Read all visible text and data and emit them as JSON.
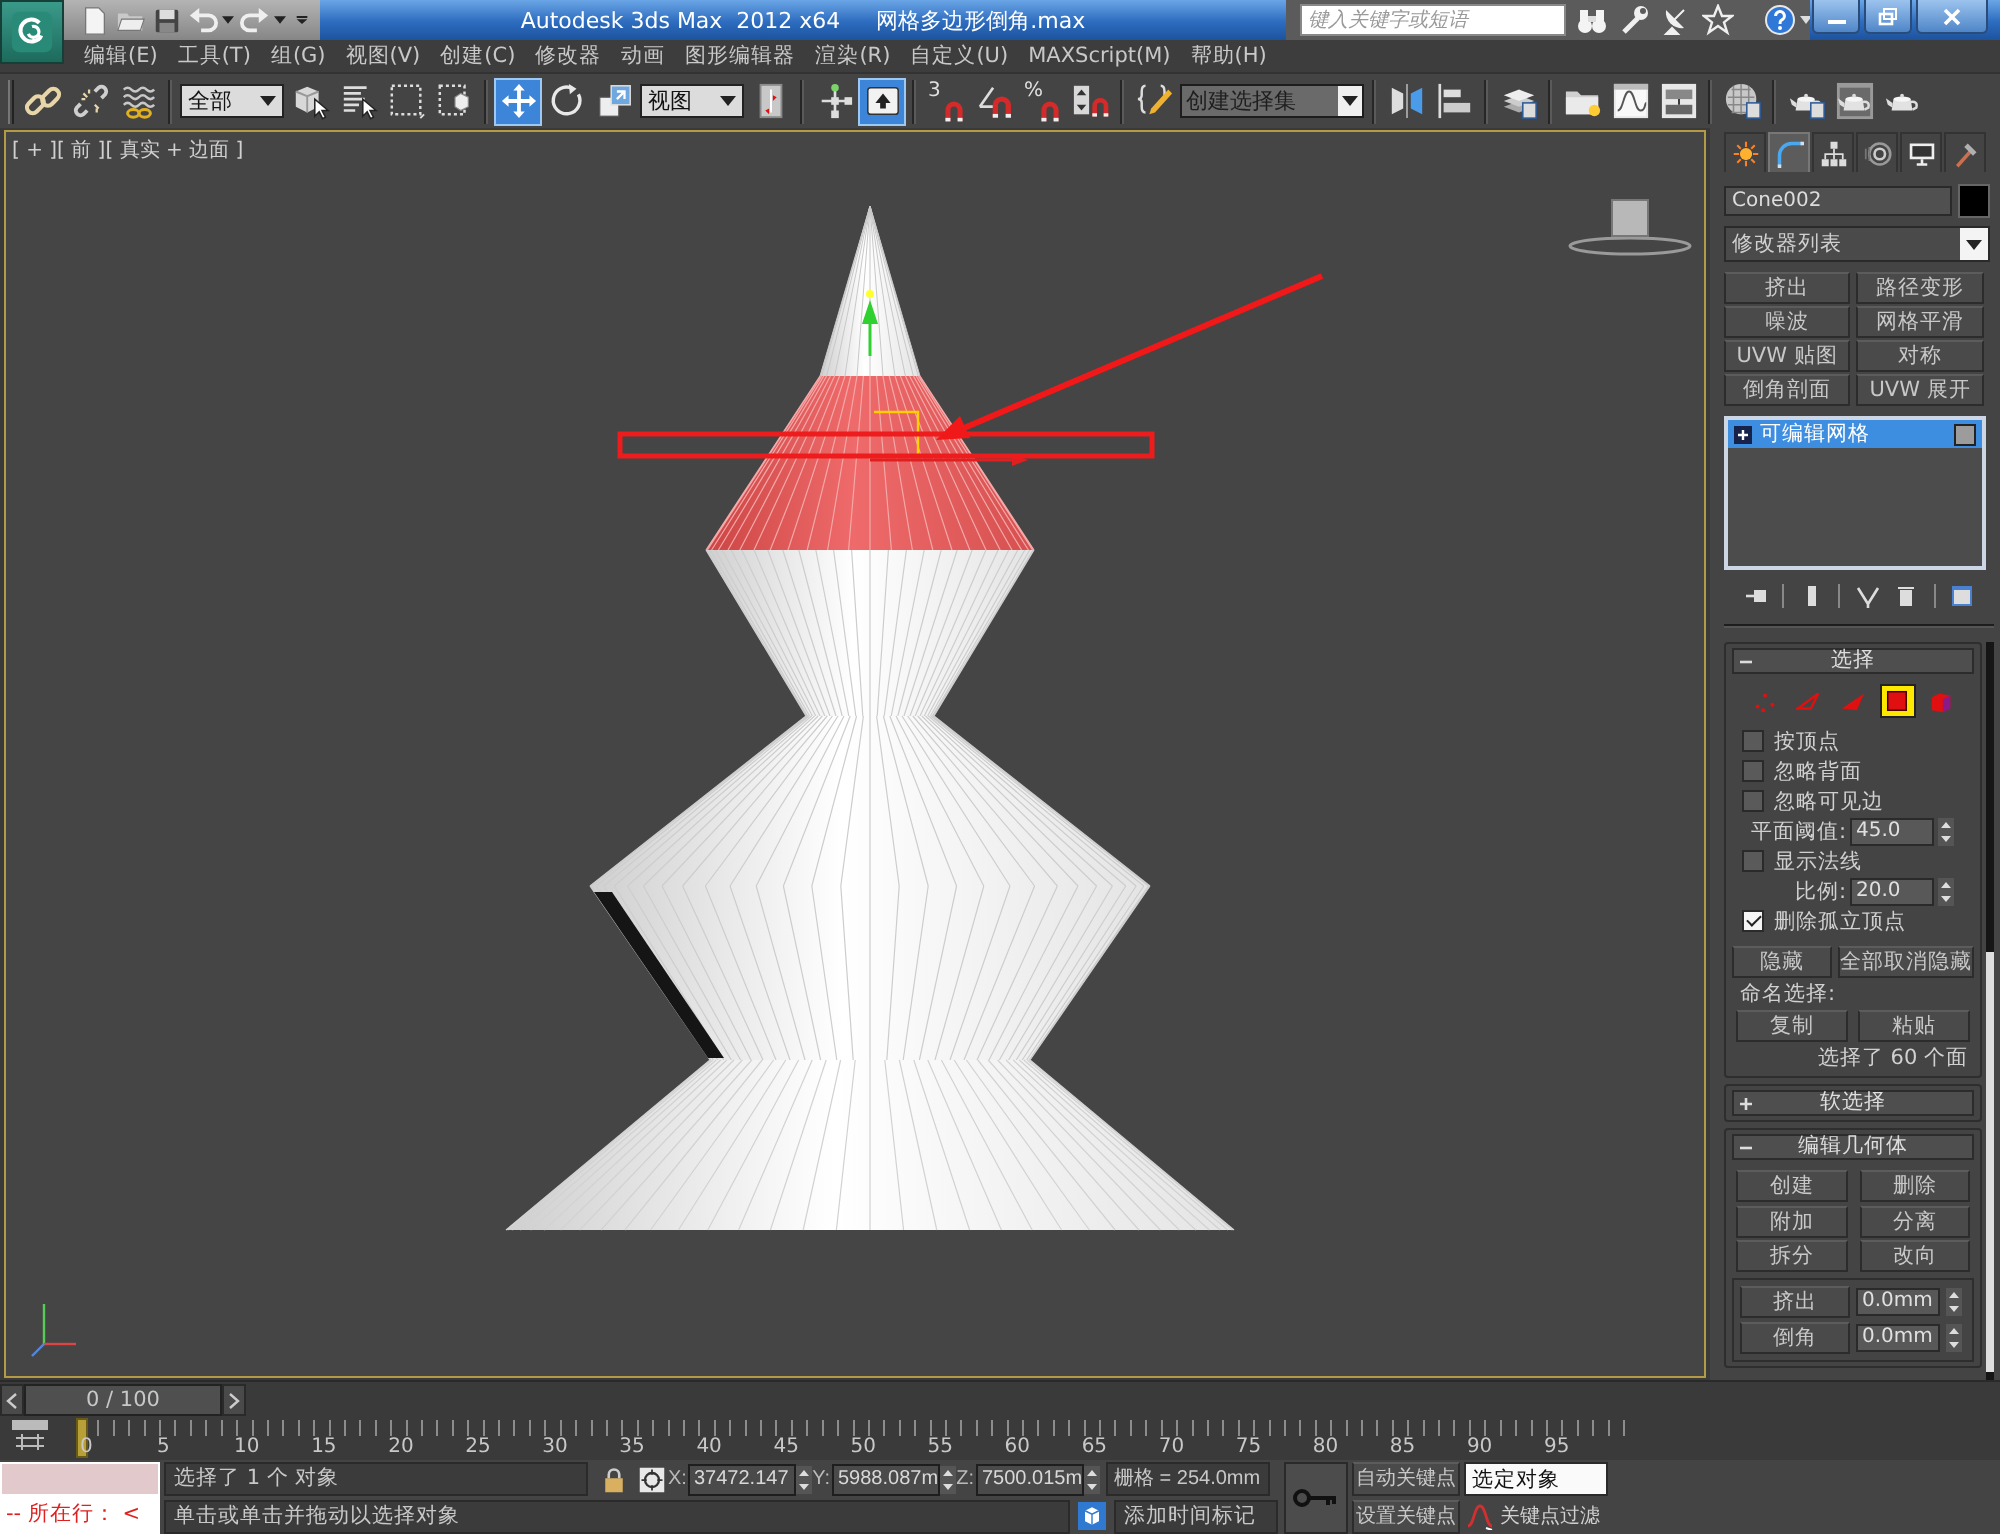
{
  "title_bar": {
    "app_name": "Autodesk 3ds Max  2012 x64",
    "file_name": "网格多边形倒角.max",
    "search": {
      "placeholder": "键入关键字或短语"
    }
  },
  "menu_bar": [
    "编辑(E)",
    "工具(T)",
    "组(G)",
    "视图(V)",
    "创建(C)",
    "修改器",
    "动画",
    "图形编辑器",
    "渲染(R)",
    "自定义(U)",
    "MAXScript(M)",
    "帮助(H)"
  ],
  "main_toolbar": {
    "groups": [
      [
        {
          "kind": "tool",
          "selected": false
        },
        {
          "kind": "tool",
          "selected": false
        },
        {
          "kind": "tool",
          "selected": false
        }
      ],
      [
        {
          "kind": "dropdown",
          "value": "全部"
        },
        {
          "kind": "tool",
          "selected": false
        },
        {
          "kind": "tool",
          "selected": false
        },
        {
          "kind": "tool",
          "selected": false
        },
        {
          "kind": "tool",
          "selected": false
        }
      ],
      [
        {
          "kind": "tool",
          "selected": true
        },
        {
          "kind": "tool",
          "selected": false
        },
        {
          "kind": "tool",
          "selected": false
        },
        {
          "kind": "dropdown",
          "value": "视图"
        },
        {
          "kind": "tool",
          "selected": false
        }
      ],
      [
        {
          "kind": "tool",
          "selected": false
        },
        {
          "kind": "tool",
          "selected": true
        }
      ],
      [
        {
          "kind": "snap",
          "label": "3",
          "selected": false
        },
        {
          "kind": "tool",
          "selected": false
        },
        {
          "kind": "snap",
          "label": "%",
          "selected": false
        },
        {
          "kind": "tool",
          "selected": false
        }
      ],
      [
        {
          "kind": "tool",
          "selected": false
        },
        {
          "kind": "combo",
          "placeholder": "创建选择集"
        }
      ],
      [
        {
          "kind": "tool",
          "selected": false
        },
        {
          "kind": "tool",
          "selected": false
        }
      ],
      [
        {
          "kind": "tool",
          "selected": false
        }
      ],
      [
        {
          "kind": "tool",
          "selected": false
        },
        {
          "kind": "tool",
          "selected": false
        },
        {
          "kind": "tool",
          "selected": false
        }
      ],
      [
        {
          "kind": "tool",
          "selected": false
        }
      ],
      [
        {
          "kind": "tool",
          "selected": false
        },
        {
          "kind": "tool",
          "selected": false
        },
        {
          "kind": "tool",
          "selected": false
        }
      ]
    ]
  },
  "viewport": {
    "label": "[ + ][ 前 ][ 真实 + 边面 ]"
  },
  "command_panel": {
    "tabs": [
      {
        "selected": false
      },
      {
        "selected": true
      },
      {
        "selected": false
      },
      {
        "selected": false
      },
      {
        "selected": false
      },
      {
        "selected": false
      }
    ],
    "object_name": "Cone002",
    "modifier_list": "修改器列表",
    "modifier_buttons": [
      "挤出",
      "路径变形",
      "噪波",
      "网格平滑",
      "UVW 贴图",
      "对称",
      "倒角剖面",
      "UVW 展开"
    ],
    "modifier_stack": [
      {
        "label": "可编辑网格",
        "selected": true
      }
    ],
    "selection_rollout": {
      "title": "选择",
      "expanded": true,
      "levels": [
        {
          "selected": false
        },
        {
          "selected": false
        },
        {
          "selected": false
        },
        {
          "selected": true
        },
        {
          "selected": false
        }
      ],
      "options": [
        {
          "kind": "checkbox",
          "label": "按顶点",
          "checked": false
        },
        {
          "kind": "checkbox",
          "label": "忽略背面",
          "checked": false
        },
        {
          "kind": "checkbox",
          "label": "忽略可见边",
          "checked": false
        },
        {
          "kind": "spinner",
          "label": "平面阈值:",
          "value": "45.0"
        },
        {
          "kind": "checkbox",
          "label": "显示法线",
          "checked": false
        },
        {
          "kind": "spinner",
          "label": "比例:",
          "value": "20.0"
        },
        {
          "kind": "checkbox",
          "label": "删除孤立顶点",
          "checked": true
        }
      ],
      "buttons": [
        "隐藏",
        "全部取消隐藏"
      ],
      "named_selection_label": "命名选择:",
      "named_selection_buttons": [
        "复制",
        "粘贴"
      ],
      "status": "选择了 60 个面"
    },
    "soft_selection_rollout": {
      "title": "软选择",
      "expanded": false
    },
    "edit_geometry_rollout": {
      "title": "编辑几何体",
      "expanded": true,
      "buttons": [
        "创建",
        "删除",
        "附加",
        "分离",
        "拆分",
        "改向"
      ],
      "spinners": [
        {
          "label": "挤出",
          "value": "0.0mm"
        },
        {
          "label": "倒角",
          "value": "0.0mm"
        }
      ]
    }
  },
  "time_slider": {
    "label": "0 / 100",
    "level": 0
  },
  "track_bar": {
    "frame_labels": [
      "0",
      "5",
      "10",
      "15",
      "20",
      "25",
      "30",
      "35",
      "40",
      "45",
      "50",
      "55",
      "60",
      "65",
      "70",
      "75",
      "80",
      "85",
      "90",
      "95"
    ]
  },
  "listener": {
    "output": "-- 所在行： <"
  },
  "status_bar": {
    "message": "选择了 1 个 对象",
    "prompt": "单击或单击并拖动以选择对象",
    "coordinates": [
      {
        "axis": "X:",
        "value": "37472.147"
      },
      {
        "axis": "Y:",
        "value": "5988.087m"
      },
      {
        "axis": "Z:",
        "value": "7500.015m"
      }
    ],
    "grid": "栅格 = 254.0mm",
    "time_tag": "添加时间标记"
  },
  "animation_controls": {
    "auto_key": "自动关键点",
    "selection_set": "选定对象",
    "set_key": "设置关键点",
    "key_filters": "关键点过滤"
  }
}
